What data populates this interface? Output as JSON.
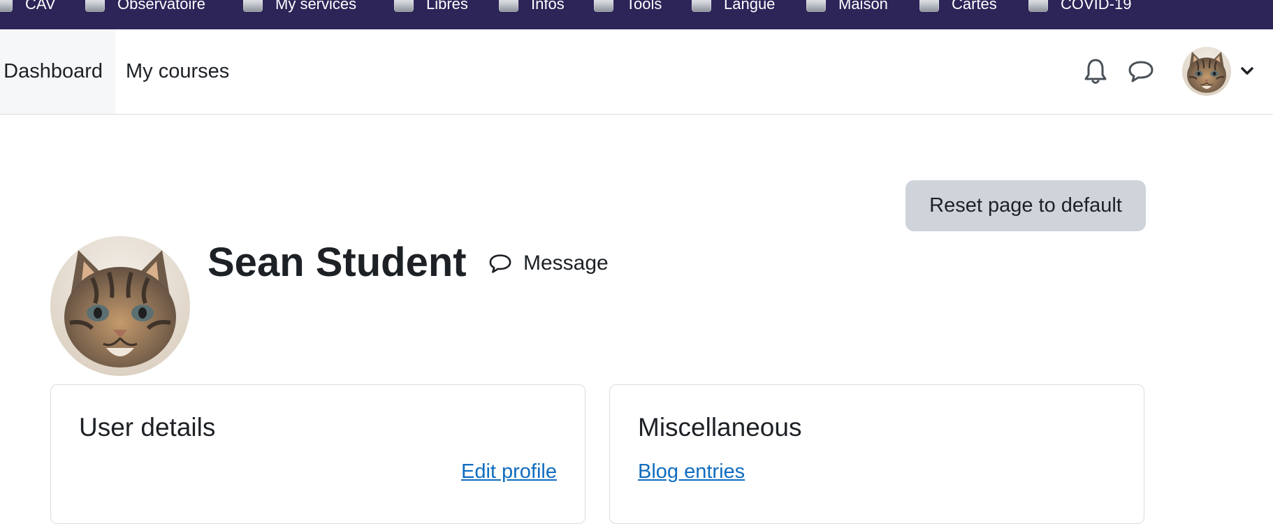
{
  "bookmarks": [
    {
      "label": "CAV",
      "icon": "folder-icon"
    },
    {
      "label": "Observatoire",
      "icon": "folder-icon"
    },
    {
      "label": "My services",
      "icon": "folder-icon"
    },
    {
      "label": "Libres",
      "icon": "folder-icon"
    },
    {
      "label": "Infos",
      "icon": "folder-icon"
    },
    {
      "label": "Tools",
      "icon": "folder-icon"
    },
    {
      "label": "Langue",
      "icon": "folder-icon"
    },
    {
      "label": "Maison",
      "icon": "folder-icon"
    },
    {
      "label": "Cartes",
      "icon": "folder-icon"
    },
    {
      "label": "COVID-19",
      "icon": "folder-icon"
    }
  ],
  "navbar": {
    "items": [
      {
        "label": "Dashboard",
        "active": true
      },
      {
        "label": "My courses",
        "active": false
      }
    ],
    "icons": [
      "bell-icon",
      "chat-icon",
      "avatar",
      "chevron-down-icon"
    ]
  },
  "page": {
    "reset_label": "Reset page to default",
    "user_name": "Sean Student",
    "message_label": "Message"
  },
  "cards": {
    "user_details": {
      "title": "User details",
      "link": "Edit profile"
    },
    "misc": {
      "title": "Miscellaneous",
      "link": "Blog entries"
    }
  },
  "colors": {
    "bookmarks_bg": "#2d2458",
    "link": "#0f6cbf",
    "button_bg": "#ced4da",
    "text": "#1d2125"
  }
}
